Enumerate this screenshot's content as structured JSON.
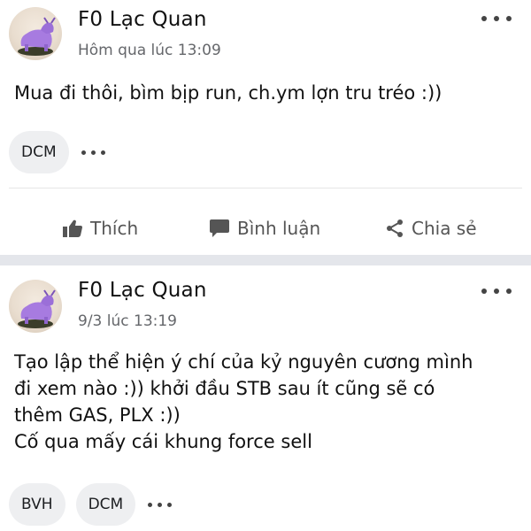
{
  "posts": [
    {
      "author": "F0 Lạc Quan",
      "timestamp": "Hôm qua lúc 13:09",
      "lines": [
        "Mua đi thôi, bìm bịp run, ch.ym lợn tru tréo :))"
      ],
      "tags": [
        "DCM"
      ],
      "actions": {
        "like": "Thích",
        "comment": "Bình luận",
        "share": "Chia sẻ"
      }
    },
    {
      "author": "F0 Lạc Quan",
      "timestamp": "9/3 lúc 13:19",
      "lines": [
        "Tạo lập thể hiện ý chí của kỷ nguyên cương mình",
        "đi xem nào :)) khởi đầu STB sau ít cũng sẽ có",
        "thêm GAS, PLX :))",
        "Cố qua mấy cái khung force sell"
      ],
      "tags": [
        "BVH",
        "DCM"
      ]
    }
  ],
  "icons": {
    "avatar": "purple-bull-statue",
    "more": "more-horizontal-icon",
    "like": "thumbs-up-icon",
    "comment": "comment-bubble-icon",
    "share": "share-icon"
  },
  "colors": {
    "separator": "#e4e6eb",
    "chip": "#eeeff1",
    "muted": "#65676b"
  }
}
